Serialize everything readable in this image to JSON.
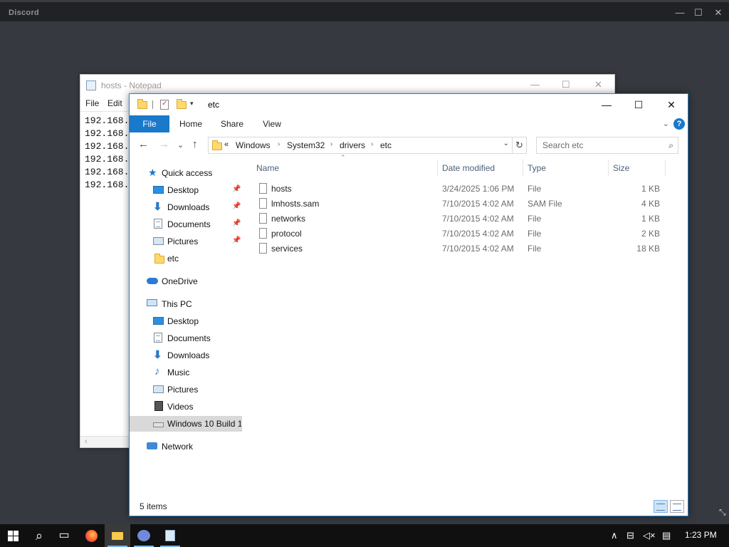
{
  "discord": {
    "title": "Discord",
    "minimize": "—",
    "maximize": "☐",
    "close": "✕"
  },
  "notepad": {
    "title": "hosts - Notepad",
    "minimize": "—",
    "maximize": "☐",
    "close": "✕",
    "menu": [
      "File",
      "Edit"
    ],
    "lines": [
      "192.168.",
      "192.168.",
      "192.168.",
      "192.168.",
      "192.168.",
      "192.168."
    ],
    "scroll_arrow": "‹"
  },
  "explorer": {
    "title": "etc",
    "quick_access_dropdown": "▾",
    "minimize": "—",
    "maximize": "☐",
    "close": "✕",
    "ribbon_tabs": [
      "File",
      "Home",
      "Share",
      "View"
    ],
    "ribbon_expand": "⌄",
    "help": "?",
    "nav": {
      "back": "←",
      "forward": "→",
      "recent": "⌄",
      "up": "↑"
    },
    "address": {
      "overflow": "«",
      "crumbs": [
        "Windows",
        "System32",
        "drivers",
        "etc"
      ],
      "separator": "›",
      "dropdown": "⌄",
      "refresh": "↻"
    },
    "search": {
      "placeholder": "Search etc",
      "icon": "⌕"
    },
    "nav_pane": [
      {
        "label": "Quick access",
        "icon": "star-icon",
        "indent": 1,
        "pinned": false
      },
      {
        "label": "Desktop",
        "icon": "desktop-icon",
        "indent": 2,
        "pinned": true
      },
      {
        "label": "Downloads",
        "icon": "download-icon",
        "indent": 2,
        "pinned": true
      },
      {
        "label": "Documents",
        "icon": "documents-icon",
        "indent": 2,
        "pinned": true
      },
      {
        "label": "Pictures",
        "icon": "pictures-icon",
        "indent": 2,
        "pinned": true
      },
      {
        "label": "etc",
        "icon": "folder-icon",
        "indent": 2,
        "pinned": false
      },
      {
        "label": "OneDrive",
        "icon": "onedrive-icon",
        "indent": 1,
        "pinned": false
      },
      {
        "label": "This PC",
        "icon": "this-pc-icon",
        "indent": 1,
        "pinned": false
      },
      {
        "label": "Desktop",
        "icon": "desktop-icon",
        "indent": 2,
        "pinned": false
      },
      {
        "label": "Documents",
        "icon": "documents-icon",
        "indent": 2,
        "pinned": false
      },
      {
        "label": "Downloads",
        "icon": "download-icon",
        "indent": 2,
        "pinned": false
      },
      {
        "label": "Music",
        "icon": "music-icon",
        "indent": 2,
        "pinned": false
      },
      {
        "label": "Pictures",
        "icon": "pictures-icon",
        "indent": 2,
        "pinned": false
      },
      {
        "label": "Videos",
        "icon": "videos-icon",
        "indent": 2,
        "pinned": false
      },
      {
        "label": "Windows 10 Build 1",
        "icon": "drive-icon",
        "indent": 2,
        "pinned": false,
        "selected": true
      },
      {
        "label": "Network",
        "icon": "network-icon",
        "indent": 1,
        "pinned": false
      }
    ],
    "pin_glyph": "📌",
    "columns": [
      "Name",
      "Date modified",
      "Type",
      "Size"
    ],
    "sort_glyph": "⌃",
    "files": [
      {
        "name": "hosts",
        "modified": "3/24/2025 1:06 PM",
        "type": "File",
        "size": "1 KB"
      },
      {
        "name": "lmhosts.sam",
        "modified": "7/10/2015 4:02 AM",
        "type": "SAM File",
        "size": "4 KB"
      },
      {
        "name": "networks",
        "modified": "7/10/2015 4:02 AM",
        "type": "File",
        "size": "1 KB"
      },
      {
        "name": "protocol",
        "modified": "7/10/2015 4:02 AM",
        "type": "File",
        "size": "2 KB"
      },
      {
        "name": "services",
        "modified": "7/10/2015 4:02 AM",
        "type": "File",
        "size": "18 KB"
      }
    ],
    "status": "5 items"
  },
  "taskbar": {
    "items": [
      "start-button",
      "search-button",
      "task-view-button",
      "firefox",
      "file-explorer",
      "discord",
      "notepad"
    ],
    "search_glyph": "⌕",
    "taskview_glyph": "▭",
    "tray_chevron": "∧",
    "network_glyph": "⊟",
    "volume_glyph": "◁×",
    "notification_glyph": "▤",
    "time": "1:23 PM"
  },
  "colors": {
    "accent": "#1979ca",
    "discord_bg": "#36393f",
    "taskbar": "#101010"
  }
}
